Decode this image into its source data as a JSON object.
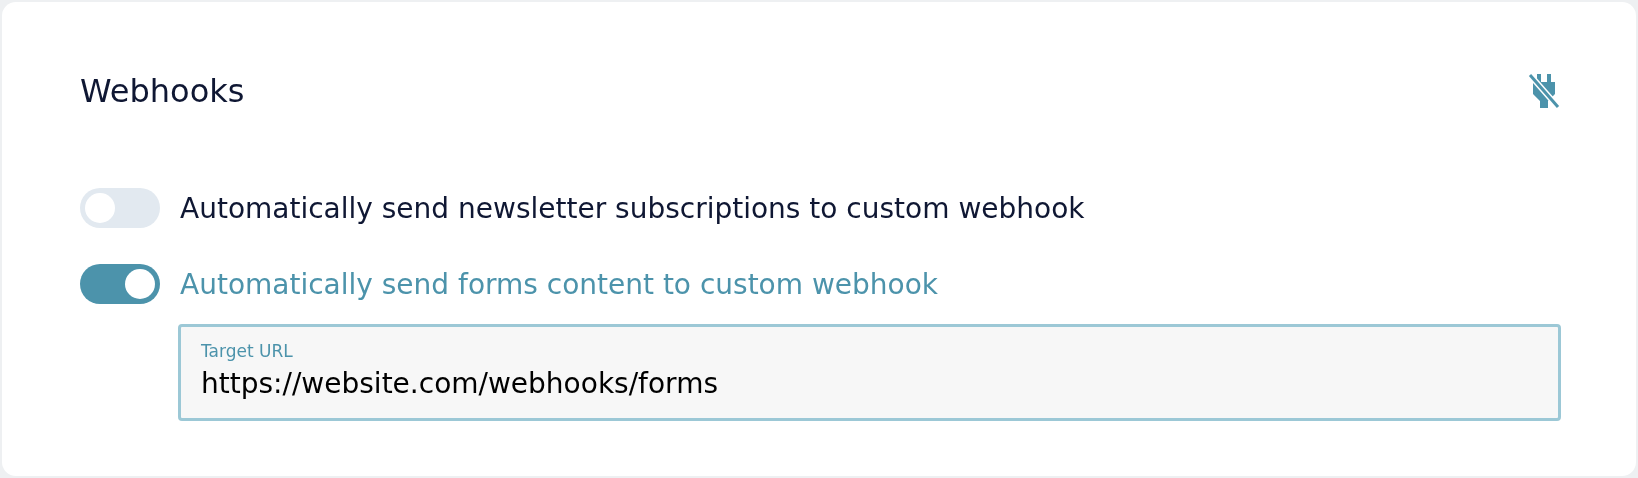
{
  "card": {
    "title": "Webhooks"
  },
  "toggles": [
    {
      "label": "Automatically send newsletter subscriptions to custom webhook",
      "on": false
    },
    {
      "label": "Automatically send forms content to custom webhook",
      "on": true,
      "field": {
        "label": "Target URL",
        "value": "https://website.com/webhooks/forms"
      }
    }
  ]
}
